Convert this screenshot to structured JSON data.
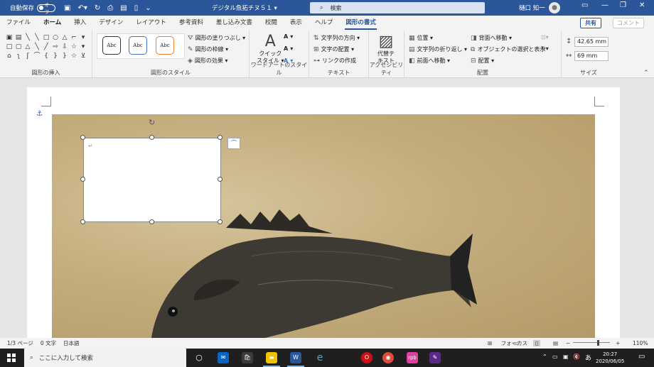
{
  "titlebar": {
    "autosave_label": "自動保存",
    "autosave_state": "オフ",
    "document_title": "デジタル魚拓チヌ５１ ▾",
    "search_placeholder": "検索",
    "user_name": "樋口 知一"
  },
  "tabs": [
    "ファイル",
    "ホーム",
    "挿入",
    "デザイン",
    "レイアウト",
    "参考資料",
    "差し込み文書",
    "校閲",
    "表示",
    "ヘルプ",
    "図形の書式"
  ],
  "share_label": "共有",
  "comment_label": "コメント",
  "ribbon": {
    "groups": {
      "insert_shapes": "図形の挿入",
      "shape_styles": "図形のスタイル",
      "wordart_styles": "ワードアートのスタイル",
      "text": "テキスト",
      "accessibility": "アクセシビリティ",
      "arrange": "配置",
      "size": "サイズ"
    },
    "style_samples": [
      "Abc",
      "Abc",
      "Abc"
    ],
    "shape_fill": "図形の塗りつぶし ▾",
    "shape_outline": "図形の枠線 ▾",
    "shape_effects": "図形の効果 ▾",
    "quick_styles": "クイック",
    "quick_styles_2": "スタイル ▾",
    "text_direction": "文字列の方向 ▾",
    "text_align": "文字の配置 ▾",
    "create_link": "リンクの作成",
    "alt_text_1": "代替テ",
    "alt_text_2": "キスト",
    "position": "位置 ▾",
    "wrap_text": "文字列の折り返し ▾",
    "bring_forward": "前面へ移動 ▾",
    "send_backward": "背面へ移動 ▾",
    "selection_pane": "オブジェクトの選択と表示",
    "align": "配置 ▾",
    "height": "42.65 mm",
    "width": "69 mm"
  },
  "status": {
    "page": "1/3 ページ",
    "words": "0 文字",
    "language": "日本語",
    "focus": "フォーカス",
    "zoom": "110%"
  },
  "taskbar": {
    "search_placeholder": "ここに入力して検索",
    "time": "20:27",
    "date": "2020/06/05",
    "ime": "あ",
    "app_rpb": "rpb"
  }
}
